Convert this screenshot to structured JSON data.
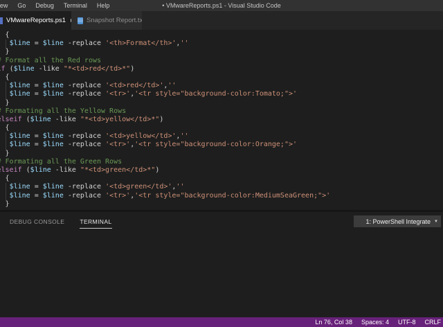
{
  "window": {
    "title": "• VMwareReports.ps1 - Visual Studio Code",
    "menus": [
      "View",
      "Go",
      "Debug",
      "Terminal",
      "Help"
    ]
  },
  "tabs": [
    {
      "label": "VMwareReports.ps1",
      "icon": "powershell-file-icon",
      "modified": true,
      "active": true
    },
    {
      "label": "Snapshot Report.txt",
      "icon": "text-file-icon",
      "modified": false,
      "active": false
    }
  ],
  "editor": {
    "language": "powershell",
    "lines": [
      {
        "g": false,
        "t": [
          [
            "p",
            "  {"
          ]
        ]
      },
      {
        "g": true,
        "t": [
          [
            "p",
            "   "
          ],
          [
            "v",
            "$line"
          ],
          [
            "p",
            " = "
          ],
          [
            "v",
            "$line"
          ],
          [
            "p",
            " -replace "
          ],
          [
            "s",
            "'<th>Format</th>'"
          ],
          [
            "p",
            ","
          ],
          [
            "s",
            "''"
          ]
        ]
      },
      {
        "g": false,
        "t": [
          [
            "p",
            "  }"
          ]
        ]
      },
      {
        "g": false,
        "t": [
          [
            "c",
            "# Format all the Red rows"
          ]
        ]
      },
      {
        "g": false,
        "t": [
          [
            "k",
            "if"
          ],
          [
            "p",
            " ("
          ],
          [
            "v",
            "$line"
          ],
          [
            "p",
            " -like "
          ],
          [
            "s",
            "\"*<td>red</td>*\""
          ],
          [
            "p",
            ")"
          ]
        ]
      },
      {
        "g": false,
        "t": [
          [
            "p",
            "  {"
          ]
        ]
      },
      {
        "g": true,
        "t": [
          [
            "p",
            "   "
          ],
          [
            "v",
            "$line"
          ],
          [
            "p",
            " = "
          ],
          [
            "v",
            "$line"
          ],
          [
            "p",
            " -replace "
          ],
          [
            "s",
            "'<td>red</td>'"
          ],
          [
            "p",
            ","
          ],
          [
            "s",
            "''"
          ]
        ]
      },
      {
        "g": true,
        "t": [
          [
            "p",
            "   "
          ],
          [
            "v",
            "$line"
          ],
          [
            "p",
            " = "
          ],
          [
            "v",
            "$line"
          ],
          [
            "p",
            " -replace "
          ],
          [
            "s",
            "'<tr>'"
          ],
          [
            "p",
            ","
          ],
          [
            "s",
            "'<tr style=\"background-color:Tomato;\">'"
          ]
        ]
      },
      {
        "g": false,
        "t": [
          [
            "p",
            "  }"
          ]
        ]
      },
      {
        "g": false,
        "t": [
          [
            "c",
            "# Formating all the Yellow Rows"
          ]
        ]
      },
      {
        "g": false,
        "t": [
          [
            "k",
            "elseif"
          ],
          [
            "p",
            " ("
          ],
          [
            "v",
            "$line"
          ],
          [
            "p",
            " -like "
          ],
          [
            "s",
            "\"*<td>yellow</td>*\""
          ],
          [
            "p",
            ")"
          ]
        ]
      },
      {
        "g": false,
        "t": [
          [
            "p",
            "  {"
          ]
        ]
      },
      {
        "g": true,
        "t": [
          [
            "p",
            "   "
          ],
          [
            "v",
            "$line"
          ],
          [
            "p",
            " = "
          ],
          [
            "v",
            "$line"
          ],
          [
            "p",
            " -replace "
          ],
          [
            "s",
            "'<td>yellow</td>'"
          ],
          [
            "p",
            ","
          ],
          [
            "s",
            "''"
          ]
        ]
      },
      {
        "g": true,
        "t": [
          [
            "p",
            "   "
          ],
          [
            "v",
            "$line"
          ],
          [
            "p",
            " = "
          ],
          [
            "v",
            "$line"
          ],
          [
            "p",
            " -replace "
          ],
          [
            "s",
            "'<tr>'"
          ],
          [
            "p",
            ","
          ],
          [
            "s",
            "'<tr style=\"background-color:Orange;\">'"
          ]
        ]
      },
      {
        "g": false,
        "t": [
          [
            "p",
            "  }"
          ]
        ]
      },
      {
        "g": false,
        "t": [
          [
            "c",
            "# Formating all the Green Rows"
          ]
        ]
      },
      {
        "g": false,
        "t": [
          [
            "k",
            "elseif"
          ],
          [
            "p",
            " ("
          ],
          [
            "v",
            "$line"
          ],
          [
            "p",
            " -like "
          ],
          [
            "s",
            "\"*<td>green</td>*\""
          ],
          [
            "p",
            ")"
          ]
        ]
      },
      {
        "g": false,
        "t": [
          [
            "p",
            "  {"
          ]
        ]
      },
      {
        "g": true,
        "t": [
          [
            "p",
            "   "
          ],
          [
            "v",
            "$line"
          ],
          [
            "p",
            " = "
          ],
          [
            "v",
            "$line"
          ],
          [
            "p",
            " -replace "
          ],
          [
            "s",
            "'<td>green</td>'"
          ],
          [
            "p",
            ","
          ],
          [
            "s",
            "''"
          ]
        ]
      },
      {
        "g": true,
        "t": [
          [
            "p",
            "   "
          ],
          [
            "v",
            "$line"
          ],
          [
            "p",
            " = "
          ],
          [
            "v",
            "$line"
          ],
          [
            "p",
            " -replace "
          ],
          [
            "s",
            "'<tr>'"
          ],
          [
            "p",
            ","
          ],
          [
            "s",
            "'<tr style=\"background-color:MediumSeaGreen;\">'"
          ]
        ]
      },
      {
        "g": false,
        "t": [
          [
            "p",
            "  }"
          ]
        ]
      }
    ]
  },
  "panel": {
    "tabs": [
      {
        "label": "DEBUG CONSOLE",
        "active": false
      },
      {
        "label": "TERMINAL",
        "active": true
      }
    ],
    "terminal_select": {
      "value": "1: PowerShell Integrate",
      "caret": "▼"
    }
  },
  "status": {
    "items": [
      {
        "name": "cursor-position",
        "label": "Ln 76, Col 38"
      },
      {
        "name": "indentation",
        "label": "Spaces: 4"
      },
      {
        "name": "encoding",
        "label": "UTF-8"
      },
      {
        "name": "eol",
        "label": "CRLF"
      }
    ]
  },
  "colors": {
    "titlebar_bg": "#323233",
    "tabbar_bg": "#252526",
    "active_tab_bg": "#1e1e1e",
    "inactive_tab_bg": "#2d2d2d",
    "editor_bg": "#1e1e1e",
    "statusbar_bg": "#68217a",
    "token_variable": "#9cdcfe",
    "token_string": "#ce9178",
    "token_comment": "#6a9955",
    "token_keyword": "#c586c0",
    "token_plain": "#d4d4d4"
  }
}
